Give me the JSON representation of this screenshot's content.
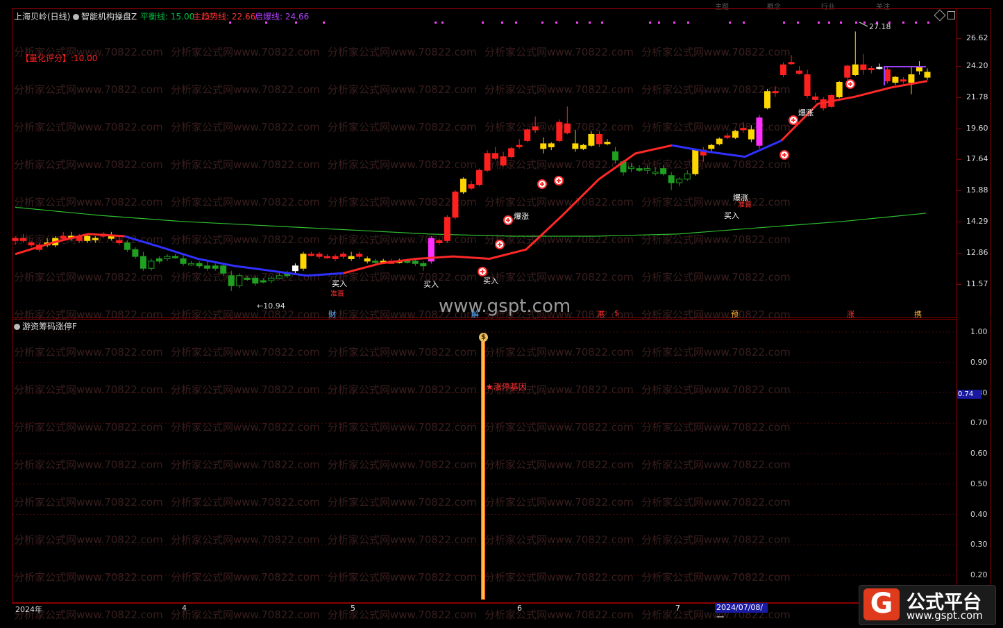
{
  "header": {
    "stock_title": "上海贝岭(日线)",
    "indicator_name": "智能机构操盘Z",
    "params": [
      {
        "label": "平衡线: 15.00",
        "color": "#00c040"
      },
      {
        "label": "主趋势线: 22.66",
        "color": "#ff3030"
      },
      {
        "label": "启爆线: 24.66",
        "color": "#b040ff"
      }
    ],
    "top_tabs": [
      "主题",
      "概念",
      "行业",
      "关注"
    ]
  },
  "score_label": "【量化评分】:10.00",
  "price_axis": {
    "ticks": [
      "26.62",
      "24.20",
      "21.78",
      "19.60",
      "17.64",
      "15.88",
      "14.29",
      "12.86",
      "11.57"
    ]
  },
  "sub_panel": {
    "title": "游资筹码涨停F",
    "ticks": [
      "1.00",
      "0.90",
      "0.80",
      "0.70",
      "0.60",
      "0.50",
      "0.40",
      "0.30",
      "0.20"
    ],
    "current_value": "0.74",
    "signal_label": "★涨停基因",
    "coin_icon": "$"
  },
  "date_axis": {
    "labels": [
      "2024年",
      "4",
      "5",
      "6",
      "7"
    ],
    "cursor_date": "2024/07/08/一"
  },
  "annotations": {
    "high_price": "27.18",
    "low_price": "←10.94",
    "buy": "买入",
    "boom": "爆涨",
    "fight": "准首",
    "markers": [
      "财",
      "解",
      "港",
      "$",
      "预",
      "涨",
      "携"
    ]
  },
  "watermark": "分析家公式网www.70822.com",
  "site_watermark": "www.gspt.com",
  "logo": {
    "glyph": "G",
    "title": "公式平台",
    "url": "www.gspt.com"
  },
  "colors": {
    "up": "#ff2020",
    "down": "#20a020",
    "yellow": "#ffd700",
    "magenta": "#ff30ff",
    "trend": "#ff2828",
    "balance": "#2fbf2f",
    "blue": "#3030ff"
  },
  "chart_data": {
    "type": "candlestick",
    "note_fields": "o,h,l,c per day",
    "y_scale": "log",
    "ylim": [
      10.5,
      28.2
    ],
    "candles": [
      [
        13.4,
        13.6,
        13.2,
        13.5,
        "r"
      ],
      [
        13.5,
        13.7,
        13.3,
        13.4,
        "r"
      ],
      [
        13.2,
        13.4,
        13.1,
        13.3,
        "r"
      ],
      [
        13.0,
        13.3,
        12.9,
        13.2,
        "r"
      ],
      [
        13.3,
        13.5,
        13.1,
        13.2,
        "y"
      ],
      [
        13.2,
        13.6,
        13.1,
        13.5,
        "y"
      ],
      [
        13.5,
        13.8,
        13.4,
        13.6,
        "r"
      ],
      [
        13.6,
        13.8,
        13.4,
        13.5,
        "y"
      ],
      [
        13.4,
        13.7,
        13.3,
        13.6,
        "r"
      ],
      [
        13.6,
        13.7,
        13.3,
        13.4,
        "y"
      ],
      [
        13.5,
        13.6,
        13.3,
        13.5,
        "y"
      ],
      [
        13.6,
        13.8,
        13.5,
        13.7,
        "r"
      ],
      [
        13.6,
        13.8,
        13.4,
        13.5,
        "y"
      ],
      [
        13.4,
        13.6,
        13.2,
        13.3,
        "r"
      ],
      [
        13.3,
        13.4,
        12.9,
        13.0,
        "g"
      ],
      [
        13.0,
        13.1,
        12.6,
        12.7,
        "g"
      ],
      [
        12.7,
        12.9,
        12.1,
        12.2,
        "g"
      ],
      [
        12.2,
        12.6,
        12.1,
        12.5,
        "gw"
      ],
      [
        12.5,
        12.7,
        12.4,
        12.6,
        "g"
      ],
      [
        12.6,
        12.8,
        12.5,
        12.7,
        "gw"
      ],
      [
        12.7,
        12.8,
        12.6,
        12.7,
        "g"
      ],
      [
        12.6,
        12.8,
        12.3,
        12.4,
        "g"
      ],
      [
        12.4,
        12.5,
        12.3,
        12.4,
        "gw"
      ],
      [
        12.4,
        12.5,
        12.2,
        12.3,
        "g"
      ],
      [
        12.3,
        12.5,
        12.1,
        12.2,
        "g"
      ],
      [
        12.2,
        12.4,
        12.1,
        12.3,
        "g"
      ],
      [
        12.3,
        12.4,
        11.9,
        12.0,
        "g"
      ],
      [
        11.9,
        12.1,
        11.3,
        11.5,
        "g"
      ],
      [
        11.5,
        12.0,
        11.4,
        11.9,
        "gw"
      ],
      [
        11.8,
        11.9,
        11.7,
        11.8,
        "g"
      ],
      [
        11.8,
        11.9,
        11.5,
        11.6,
        "g"
      ],
      [
        11.7,
        11.8,
        11.6,
        11.7,
        "g"
      ],
      [
        11.7,
        11.9,
        11.6,
        11.8,
        "gw"
      ],
      [
        11.8,
        12.0,
        11.8,
        11.9,
        "gw"
      ],
      [
        11.9,
        12.1,
        11.8,
        12.0,
        "g"
      ],
      [
        12.1,
        12.4,
        12.0,
        12.3,
        "w"
      ],
      [
        12.2,
        12.9,
        12.1,
        12.8,
        "y"
      ],
      [
        12.8,
        12.9,
        12.7,
        12.8,
        "r"
      ],
      [
        12.7,
        12.9,
        12.6,
        12.8,
        "r"
      ],
      [
        12.7,
        12.8,
        12.6,
        12.7,
        "r"
      ],
      [
        12.6,
        12.8,
        12.5,
        12.7,
        "r"
      ],
      [
        12.7,
        12.9,
        12.6,
        12.8,
        "r"
      ],
      [
        12.6,
        12.9,
        12.5,
        12.7,
        "y"
      ],
      [
        12.7,
        12.9,
        12.6,
        12.8,
        "r"
      ],
      [
        12.6,
        12.7,
        12.4,
        12.5,
        "y"
      ],
      [
        12.5,
        12.6,
        12.4,
        12.5,
        "g"
      ],
      [
        12.5,
        12.6,
        12.4,
        12.5,
        "y"
      ],
      [
        12.4,
        12.6,
        12.4,
        12.5,
        "r"
      ],
      [
        12.5,
        12.6,
        12.4,
        12.5,
        "y"
      ],
      [
        12.5,
        12.6,
        12.4,
        12.5,
        "g"
      ],
      [
        12.4,
        12.6,
        12.3,
        12.5,
        "g"
      ],
      [
        12.3,
        12.5,
        12.1,
        12.4,
        "g"
      ],
      [
        12.5,
        13.6,
        12.4,
        13.5,
        "m"
      ],
      [
        13.3,
        13.5,
        13.2,
        13.4,
        "r"
      ],
      [
        13.4,
        14.6,
        13.3,
        14.5,
        "r"
      ],
      [
        14.5,
        15.9,
        14.4,
        15.8,
        "r"
      ],
      [
        15.8,
        16.6,
        15.7,
        16.5,
        "y"
      ],
      [
        16.0,
        16.4,
        15.9,
        16.2,
        "r"
      ],
      [
        16.2,
        17.1,
        16.1,
        17.0,
        "r"
      ],
      [
        17.0,
        18.2,
        16.9,
        18.0,
        "r"
      ],
      [
        18.0,
        18.4,
        17.6,
        17.7,
        "r"
      ],
      [
        17.3,
        18.1,
        17.2,
        17.8,
        "r"
      ],
      [
        17.8,
        18.4,
        17.7,
        18.3,
        "r"
      ],
      [
        18.5,
        18.9,
        18.3,
        18.5,
        "r"
      ],
      [
        18.8,
        19.6,
        18.7,
        19.5,
        "r"
      ],
      [
        19.7,
        20.4,
        19.3,
        19.5,
        "r"
      ],
      [
        18.6,
        19.0,
        18.0,
        18.3,
        "y"
      ],
      [
        18.4,
        18.7,
        18.2,
        18.6,
        "y"
      ],
      [
        18.8,
        20.2,
        18.7,
        20.0,
        "r"
      ],
      [
        19.9,
        21.1,
        19.2,
        19.3,
        "r"
      ],
      [
        18.6,
        19.5,
        18.1,
        18.3,
        "y"
      ],
      [
        18.3,
        18.6,
        18.2,
        18.5,
        "y"
      ],
      [
        18.5,
        19.4,
        18.4,
        19.2,
        "y"
      ],
      [
        19.2,
        19.4,
        18.4,
        18.6,
        "r"
      ],
      [
        18.6,
        18.9,
        18.5,
        18.7,
        "y"
      ],
      [
        18.1,
        18.4,
        17.4,
        17.6,
        "g"
      ],
      [
        16.9,
        17.6,
        16.7,
        17.5,
        "g"
      ],
      [
        17.2,
        17.4,
        16.9,
        17.1,
        "gw"
      ],
      [
        17.1,
        17.3,
        16.9,
        17.0,
        "g"
      ],
      [
        17.1,
        17.3,
        16.8,
        17.0,
        "gw"
      ],
      [
        16.9,
        17.2,
        16.7,
        16.9,
        "gw"
      ],
      [
        17.1,
        17.3,
        16.7,
        16.8,
        "g"
      ],
      [
        16.7,
        16.9,
        15.9,
        16.3,
        "g"
      ],
      [
        16.3,
        16.6,
        16.1,
        16.5,
        "gw"
      ],
      [
        16.5,
        17.0,
        16.4,
        16.8,
        "gw"
      ],
      [
        16.8,
        18.3,
        16.7,
        18.2,
        "y"
      ],
      [
        17.9,
        18.4,
        17.5,
        18.2,
        "r"
      ],
      [
        18.3,
        18.6,
        18.1,
        18.5,
        "y"
      ],
      [
        18.6,
        19.0,
        18.5,
        18.9,
        "y"
      ],
      [
        19.0,
        19.3,
        18.9,
        19.1,
        "r"
      ],
      [
        19.0,
        19.5,
        18.9,
        19.4,
        "y"
      ],
      [
        19.5,
        20.0,
        19.3,
        19.6,
        "r"
      ],
      [
        19.5,
        19.8,
        18.7,
        18.9,
        "y"
      ],
      [
        18.5,
        20.5,
        18.3,
        20.3,
        "m"
      ],
      [
        21.0,
        22.4,
        20.9,
        22.2,
        "y"
      ],
      [
        22.2,
        22.6,
        21.8,
        22.1,
        "r"
      ],
      [
        23.5,
        24.5,
        23.3,
        24.3,
        "r"
      ],
      [
        24.5,
        25.1,
        24.3,
        24.4,
        "r"
      ],
      [
        23.8,
        24.2,
        23.5,
        23.6,
        "r"
      ],
      [
        23.5,
        23.9,
        21.7,
        21.9,
        "r"
      ],
      [
        21.8,
        22.1,
        21.4,
        21.6,
        "r"
      ],
      [
        21.6,
        21.8,
        20.8,
        21.0,
        "r"
      ],
      [
        21.1,
        22.0,
        21.0,
        21.9,
        "r"
      ],
      [
        21.8,
        23.0,
        21.7,
        22.9,
        "y"
      ],
      [
        23.3,
        24.3,
        23.1,
        24.2,
        "r"
      ],
      [
        23.5,
        27.2,
        23.4,
        24.3,
        "y"
      ],
      [
        24.3,
        25.2,
        23.5,
        23.9,
        "r"
      ],
      [
        24.0,
        24.2,
        23.6,
        24.0,
        "r"
      ],
      [
        24.1,
        24.4,
        23.9,
        24.1,
        "w"
      ],
      [
        23.9,
        24.1,
        22.8,
        23.0,
        "r"
      ],
      [
        22.9,
        23.4,
        22.7,
        23.3,
        "y"
      ],
      [
        23.0,
        23.3,
        22.8,
        23.1,
        "r"
      ],
      [
        23.5,
        24.2,
        22.0,
        22.9,
        "y"
      ],
      [
        24.1,
        24.6,
        23.5,
        23.8,
        "y"
      ],
      [
        23.7,
        24.0,
        23.1,
        23.3,
        "y"
      ]
    ],
    "series": [
      {
        "values": [
          12.8,
          13.3,
          13.7,
          13.6,
          13.1,
          12.6,
          12.3,
          12.1,
          11.9,
          12.0,
          12.4,
          12.6,
          12.7,
          12.6,
          13.0,
          14.6,
          16.5,
          18.0,
          18.5,
          18.1,
          17.8,
          18.8,
          21.3,
          21.8,
          22.5,
          23.0
        ]
      }
    ],
    "balance_line": {
      "values": [
        15.0,
        14.6,
        14.3,
        14.1,
        13.9,
        13.7,
        13.6,
        13.6,
        13.7,
        14.0,
        14.3,
        14.7
      ]
    },
    "sub_value_at_peak": 1.0
  }
}
